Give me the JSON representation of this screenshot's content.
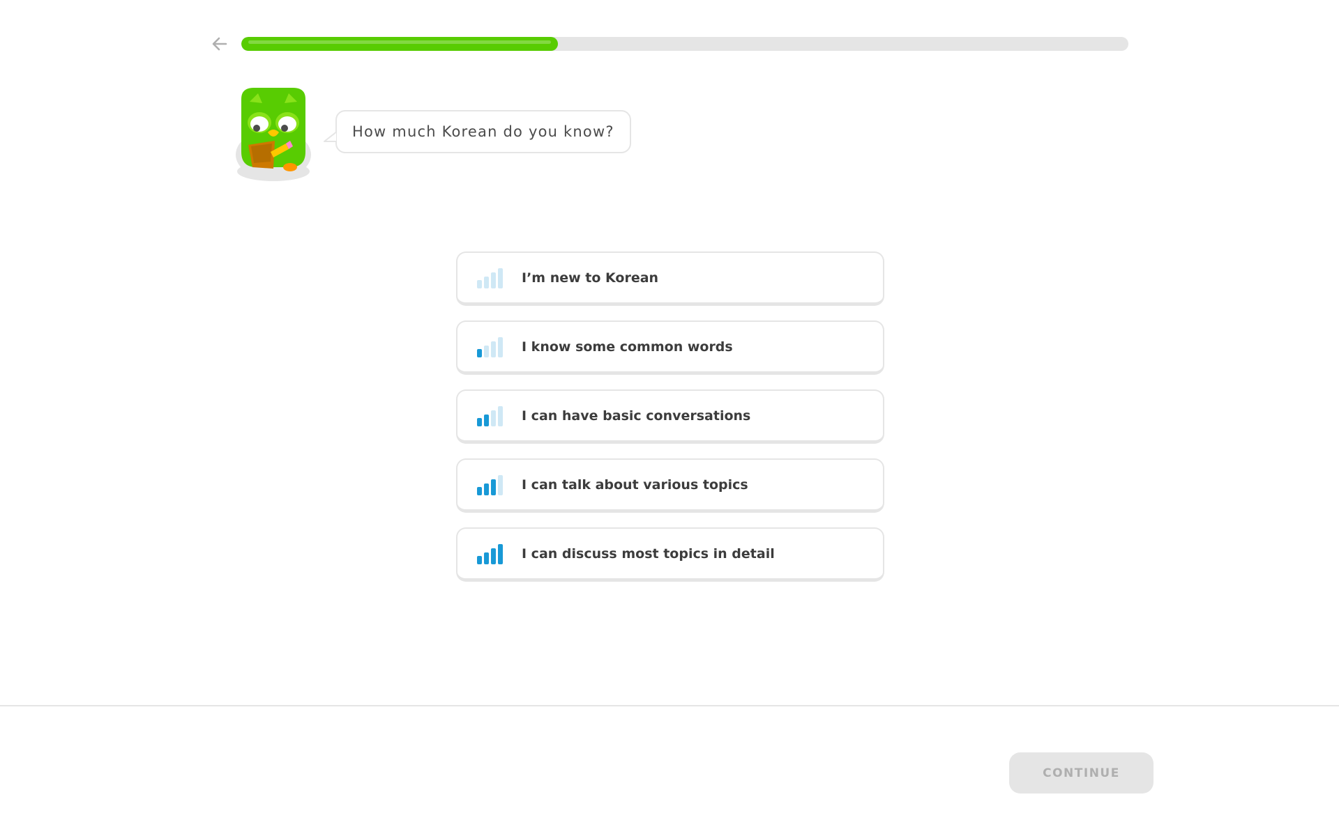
{
  "header": {
    "back_icon": "arrow-left-icon",
    "progress": 0.357,
    "progress_color": "#58cc02",
    "track_color": "#e5e5e5"
  },
  "mascot": {
    "icon": "owl-mascot-with-notepad"
  },
  "prompt": {
    "text": "How much Korean do you know?"
  },
  "options": [
    {
      "label": "I’m new to Korean",
      "level": 0
    },
    {
      "label": "I know some common words",
      "level": 1
    },
    {
      "label": "I can have basic conversations",
      "level": 2
    },
    {
      "label": "I can talk about various topics",
      "level": 3
    },
    {
      "label": "I can discuss most topics in detail",
      "level": 4
    }
  ],
  "level_colors": {
    "active": "#1899d6",
    "inactive": "#cfe8f5"
  },
  "footer": {
    "continue_label": "CONTINUE",
    "continue_disabled": true
  }
}
